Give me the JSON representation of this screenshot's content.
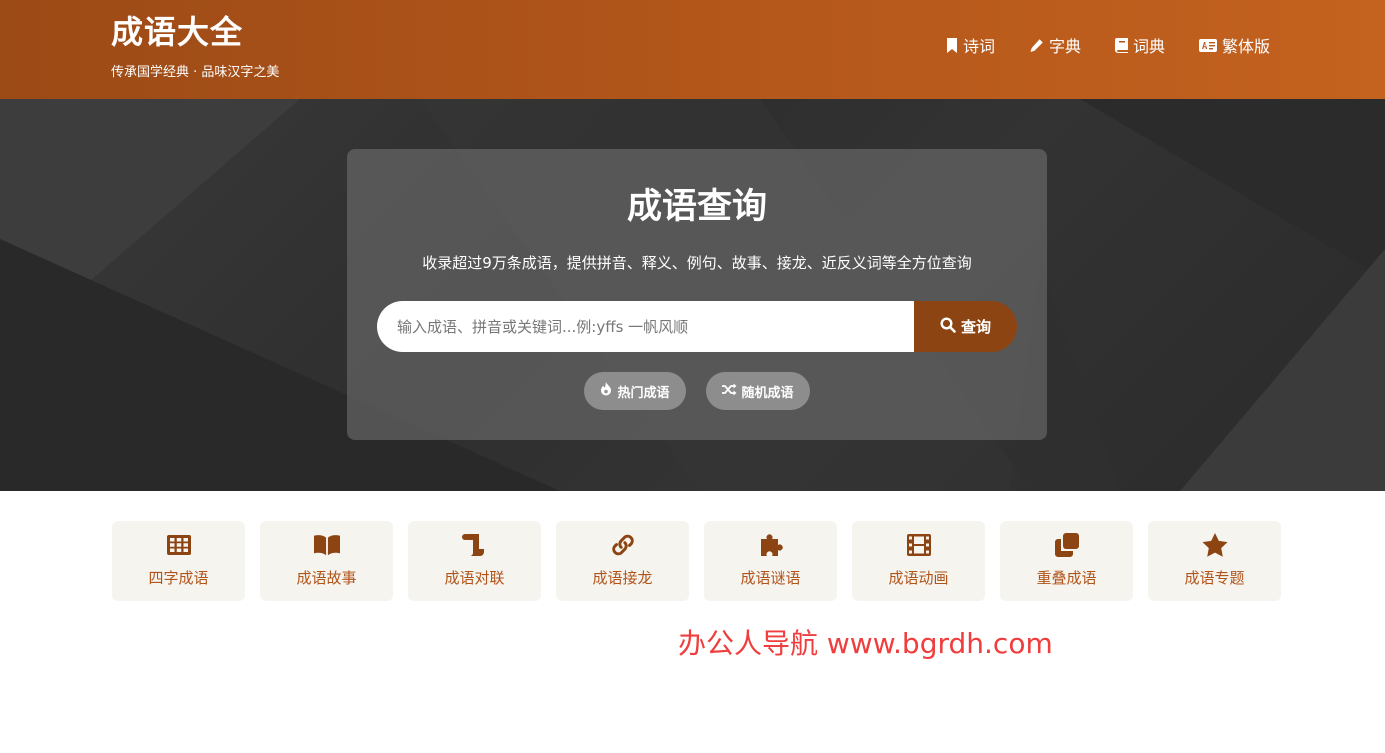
{
  "header": {
    "title": "成语大全",
    "subtitle": "传承国学经典 · 品味汉字之美",
    "nav": [
      {
        "label": "诗词",
        "icon": "bookmark-icon"
      },
      {
        "label": "字典",
        "icon": "pencil-icon"
      },
      {
        "label": "词典",
        "icon": "book-icon"
      },
      {
        "label": "繁体版",
        "icon": "language-icon"
      }
    ]
  },
  "hero": {
    "title": "成语查询",
    "description": "收录超过9万条成语，提供拼音、释义、例句、故事、接龙、近反义词等全方位查询",
    "search": {
      "placeholder": "输入成语、拼音或关键词...例:yffs 一帆风顺",
      "value": "",
      "button_label": "查询",
      "button_icon": "search-icon"
    },
    "quick_links": [
      {
        "label": "热门成语",
        "icon": "fire-icon"
      },
      {
        "label": "随机成语",
        "icon": "shuffle-icon"
      }
    ]
  },
  "categories": [
    {
      "label": "四字成语",
      "icon": "grid-icon"
    },
    {
      "label": "成语故事",
      "icon": "open-book-icon"
    },
    {
      "label": "成语对联",
      "icon": "scroll-icon"
    },
    {
      "label": "成语接龙",
      "icon": "link-icon"
    },
    {
      "label": "成语谜语",
      "icon": "puzzle-icon"
    },
    {
      "label": "成语动画",
      "icon": "film-icon"
    },
    {
      "label": "重叠成语",
      "icon": "clone-icon"
    },
    {
      "label": "成语专题",
      "icon": "star-icon"
    }
  ],
  "watermark": "办公人导航 www.bgrdh.com",
  "colors": {
    "header_start": "#9c4a16",
    "header_end": "#c4621f",
    "accent": "#8c4412",
    "tile_text": "#b0541a",
    "tile_bg": "#f6f4ef",
    "watermark": "#f03d3d"
  }
}
